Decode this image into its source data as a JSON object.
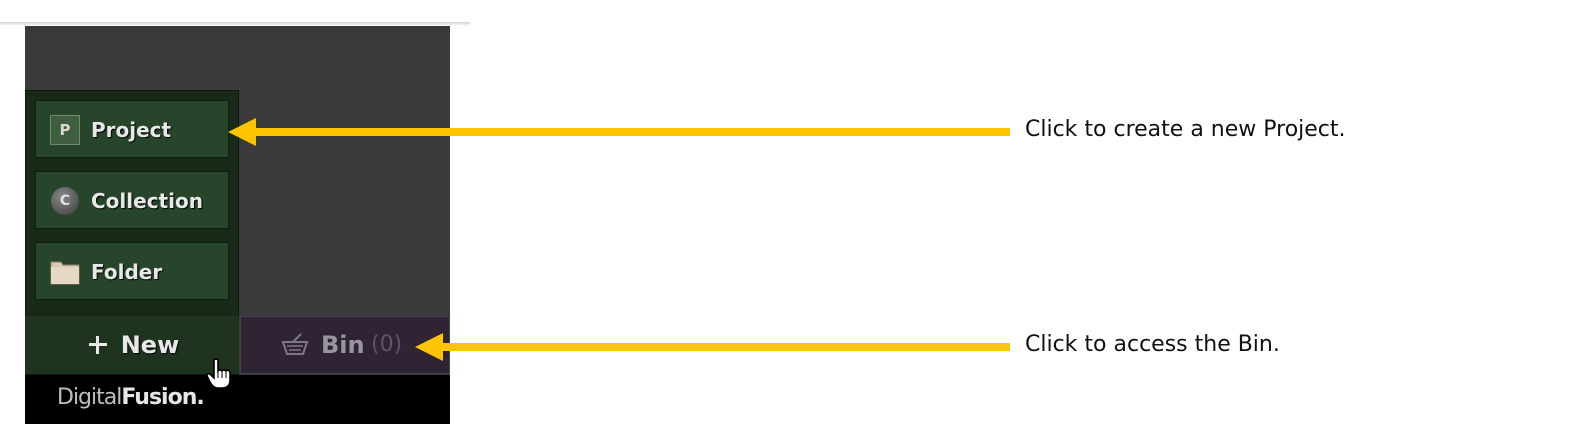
{
  "menu": {
    "items": [
      {
        "label": "Project",
        "icon": "project-icon",
        "icon_text": "P"
      },
      {
        "label": "Collection",
        "icon": "collection-icon",
        "icon_text": "C"
      },
      {
        "label": "Folder",
        "icon": "folder-icon"
      }
    ]
  },
  "toolbar": {
    "new_label": "New",
    "new_icon": "plus-icon",
    "bin_label": "Bin",
    "bin_count": "(0)",
    "bin_icon": "basket-icon"
  },
  "footer": {
    "brand_light": "Digital",
    "brand_bold": "Fusion."
  },
  "callouts": {
    "project": "Click to create a new Project.",
    "bin": "Click to access the Bin."
  },
  "colors": {
    "arrow": "#ffc400",
    "menu_bg": "#172a17",
    "bin_bg": "#2f2434"
  }
}
